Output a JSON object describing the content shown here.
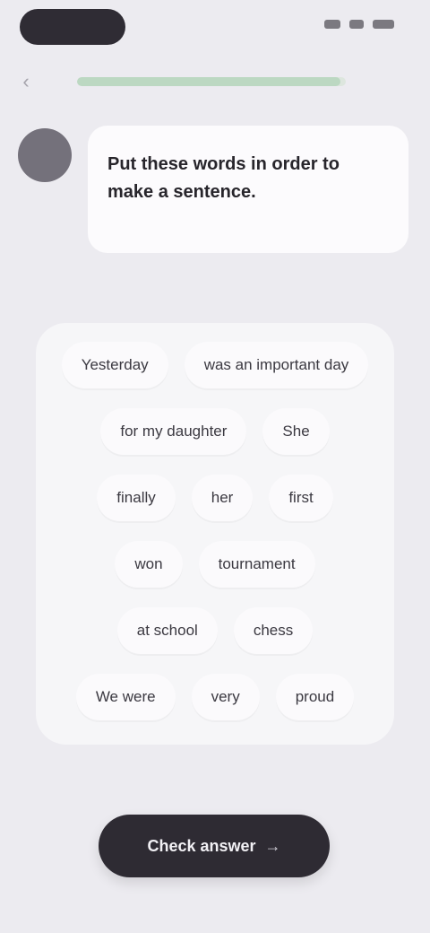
{
  "lesson": {
    "progress": 0.98,
    "prompt": "Put these words in order to make a sentence."
  },
  "word_bank": [
    [
      "Yesterday",
      "was an important day"
    ],
    [
      "for my daughter",
      "She"
    ],
    [
      "finally",
      "her",
      "first"
    ],
    [
      "won",
      "tournament"
    ],
    [
      "at school",
      "chess"
    ],
    [
      "We were",
      "very",
      "proud"
    ]
  ],
  "actions": {
    "check_label": "Check answer",
    "back_glyph": "‹",
    "check_glyph": "→"
  },
  "icons": {
    "back": "chevron-left-icon",
    "avatar": "tutor-avatar",
    "check": "arrow-right-icon"
  },
  "colors": {
    "accent": "#2e2b33",
    "progress": "#bcd8c2",
    "background": "#ecebf0"
  }
}
